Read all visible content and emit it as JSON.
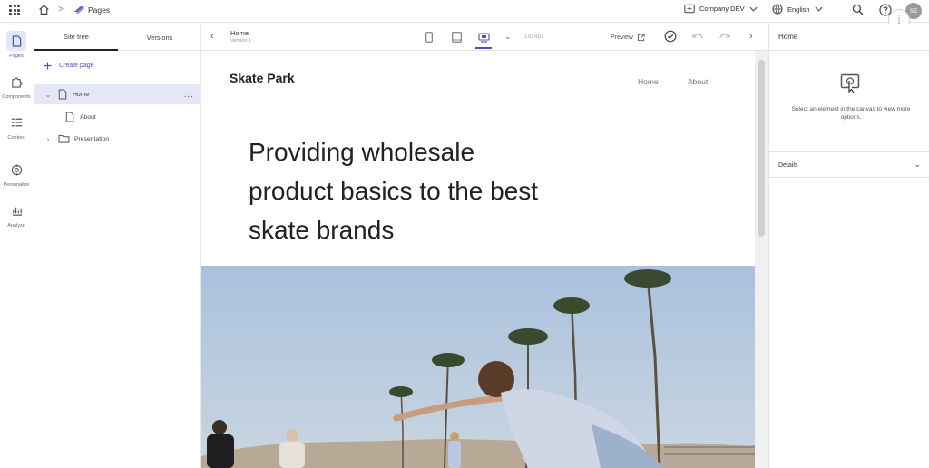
{
  "topbar": {
    "breadcrumb_sep": ">",
    "breadcrumb_page": "Pages",
    "site_name": "Company DEV",
    "language": "English",
    "avatar_initials": "SE"
  },
  "nav_rail": [
    {
      "label": "Pages",
      "icon": "page-icon",
      "active": true
    },
    {
      "label": "Components",
      "icon": "puzzle-icon",
      "active": false
    },
    {
      "label": "Content",
      "icon": "content-icon",
      "active": false
    },
    {
      "label": "Personalize",
      "icon": "target-icon",
      "active": false
    },
    {
      "label": "Analyze",
      "icon": "analyze-icon",
      "active": false
    }
  ],
  "tree_panel": {
    "tabs": [
      "Site tree",
      "Versions"
    ],
    "create_page": "Create page",
    "items": [
      {
        "label": "Home",
        "expanded": true,
        "selected": true
      },
      {
        "label": "About",
        "expanded": false,
        "selected": false
      },
      {
        "label": "Presentation",
        "expanded": false,
        "selected": false
      }
    ],
    "more": "..."
  },
  "canvas_toolbar": {
    "page_title": "Home",
    "page_version": "Version 1",
    "width_label": "1024px",
    "preview_label": "Preview"
  },
  "page_preview": {
    "brand": "Skate Park",
    "nav": [
      "Home",
      "About"
    ],
    "hero_line1": "Providing wholesale",
    "hero_line2": "product basics to the best",
    "hero_line3": "skate brands"
  },
  "right_panel": {
    "title": "Home",
    "hint": "Select an element in the canvas to view more options.",
    "section": "Details"
  },
  "colors": {
    "accent": "#4f52b2",
    "selected_bg": "#e6e7f6"
  }
}
